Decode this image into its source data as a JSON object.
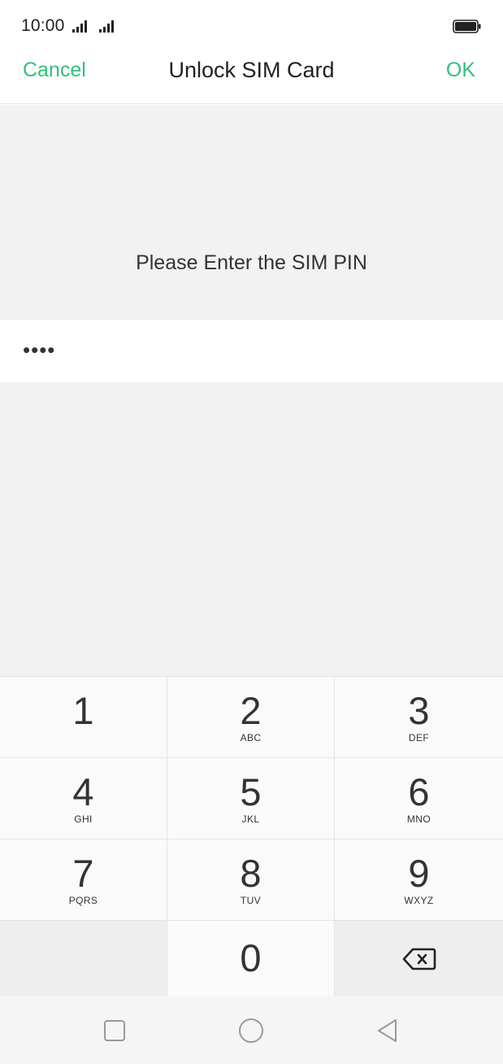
{
  "status_bar": {
    "time": "10:00",
    "icons": [
      "signal-icon",
      "signal-icon",
      "battery-icon"
    ]
  },
  "header": {
    "cancel_label": "Cancel",
    "title": "Unlock SIM Card",
    "ok_label": "OK"
  },
  "prompt": {
    "text": "Please Enter the SIM PIN"
  },
  "pin": {
    "value": "••••"
  },
  "keypad": {
    "keys": [
      {
        "digit": "1",
        "letters": ""
      },
      {
        "digit": "2",
        "letters": "ABC"
      },
      {
        "digit": "3",
        "letters": "DEF"
      },
      {
        "digit": "4",
        "letters": "GHI"
      },
      {
        "digit": "5",
        "letters": "JKL"
      },
      {
        "digit": "6",
        "letters": "MNO"
      },
      {
        "digit": "7",
        "letters": "PQRS"
      },
      {
        "digit": "8",
        "letters": "TUV"
      },
      {
        "digit": "9",
        "letters": "WXYZ"
      },
      {
        "digit": "0",
        "letters": ""
      }
    ],
    "backspace_icon": "backspace-icon"
  },
  "nav_bar": {
    "icons": [
      "recent-apps-icon",
      "home-icon",
      "back-icon"
    ]
  },
  "colors": {
    "accent": "#2fc27a",
    "panel_bg": "#f2f2f2",
    "text": "#333333"
  }
}
